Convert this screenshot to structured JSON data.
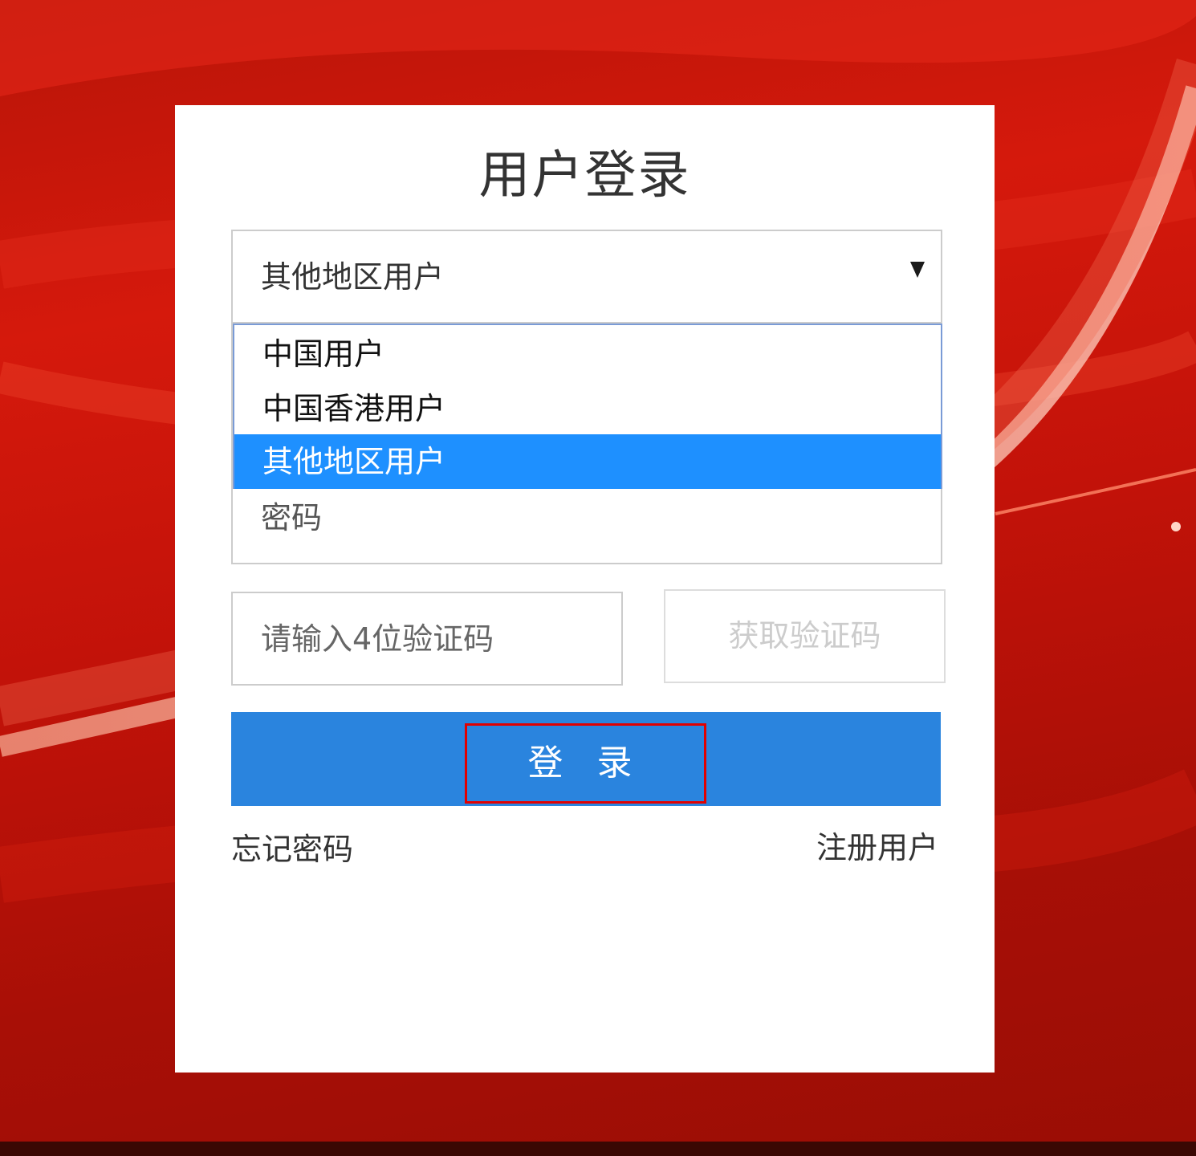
{
  "page": {
    "title": "用户登录"
  },
  "colors": {
    "background": "#c8150a",
    "card": "#ffffff",
    "primary": "#2a84de",
    "selected_option": "#1e90ff",
    "highlight_border": "#e10000"
  },
  "region_select": {
    "value": "其他地区用户",
    "icon": "triangle-down-icon",
    "options": [
      {
        "label": "中国用户",
        "selected": false
      },
      {
        "label": "中国香港用户",
        "selected": false
      },
      {
        "label": "其他地区用户",
        "selected": true
      }
    ]
  },
  "password": {
    "placeholder": "密码"
  },
  "verification": {
    "placeholder": "请输入4位验证码",
    "get_code_label": "获取验证码"
  },
  "login_button": {
    "label": "登 录"
  },
  "links": {
    "forgot_password": "忘记密码",
    "register": "注册用户"
  }
}
